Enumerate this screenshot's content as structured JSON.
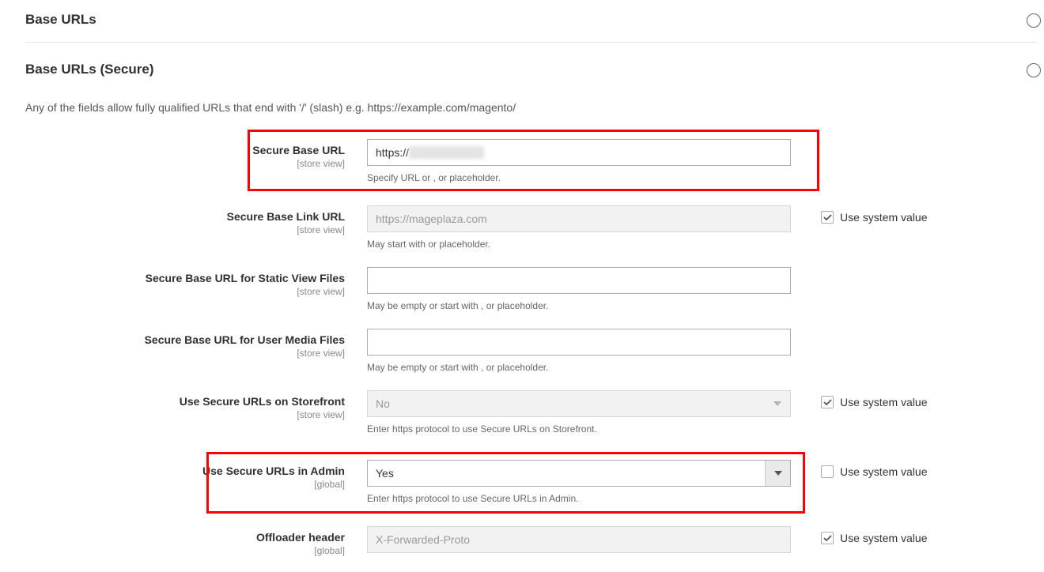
{
  "sections": {
    "base_urls": "Base URLs",
    "base_urls_secure": "Base URLs (Secure)"
  },
  "intro": "Any of the fields allow fully qualified URLs that end with '/' (slash) e.g. https://example.com/magento/",
  "scope": {
    "store_view": "[store view]",
    "global": "[global]"
  },
  "sys_label": "Use system value",
  "fields": {
    "secure_base_url": {
      "label": "Secure Base URL",
      "value_prefix": "https://",
      "hint": "Specify URL or , or placeholder."
    },
    "secure_base_link_url": {
      "label": "Secure Base Link URL",
      "value": "https://mageplaza.com",
      "hint": "May start with or placeholder."
    },
    "secure_base_url_static": {
      "label": "Secure Base URL for Static View Files",
      "value": "",
      "hint": "May be empty or start with , or placeholder."
    },
    "secure_base_url_media": {
      "label": "Secure Base URL for User Media Files",
      "value": "",
      "hint": "May be empty or start with , or placeholder."
    },
    "use_secure_storefront": {
      "label": "Use Secure URLs on Storefront",
      "value": "No",
      "hint": "Enter https protocol to use Secure URLs on Storefront."
    },
    "use_secure_admin": {
      "label": "Use Secure URLs in Admin",
      "value": "Yes",
      "hint": "Enter https protocol to use Secure URLs in Admin."
    },
    "offloader_header": {
      "label": "Offloader header",
      "value": "X-Forwarded-Proto"
    }
  }
}
